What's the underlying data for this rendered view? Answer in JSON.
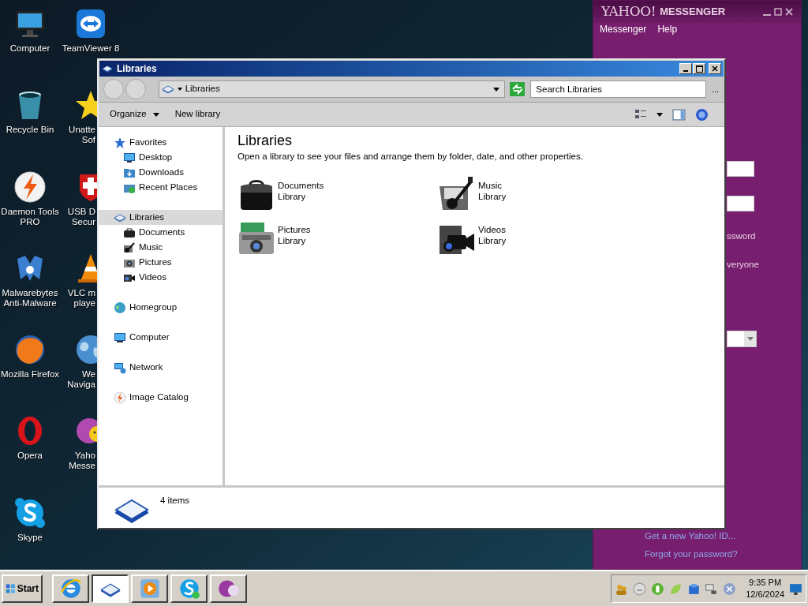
{
  "desktop": {
    "columns": [
      [
        {
          "lines": [
            "Computer"
          ]
        },
        {
          "lines": [
            "Recycle Bin"
          ]
        },
        {
          "lines": [
            "Daemon Tools",
            "PRO"
          ]
        },
        {
          "lines": [
            "Malwarebytes",
            "Anti-Malware"
          ]
        },
        {
          "lines": [
            "Mozilla Firefox"
          ]
        },
        {
          "lines": [
            "Opera"
          ]
        },
        {
          "lines": [
            "Skype"
          ]
        }
      ],
      [
        {
          "lines": [
            "TeamViewer 8"
          ]
        },
        {
          "lines": [
            "Unatte",
            "Sof"
          ]
        },
        {
          "lines": [
            "USB D",
            "Secur"
          ]
        },
        {
          "lines": [
            "VLC m",
            "playe"
          ]
        },
        {
          "lines": [
            "We",
            "Naviga"
          ]
        },
        {
          "lines": [
            "Yaho",
            "Messe"
          ]
        }
      ]
    ]
  },
  "messenger": {
    "logo": "YAHOO!",
    "title": "MESSENGER",
    "menu": [
      "Messenger",
      "Help"
    ],
    "form": [
      {
        "kind": "input"
      },
      {
        "kind": "input"
      },
      {
        "kind": "text",
        "text": "ssword"
      },
      {
        "kind": "text",
        "text": "veryone"
      },
      {
        "kind": "select"
      }
    ],
    "links": [
      "Get a new Yahoo! ID...",
      "Forgot your password?"
    ]
  },
  "explorer": {
    "title": "Libraries",
    "address": "Libraries",
    "search": {
      "placeholder": "Search Libraries"
    },
    "more": "...",
    "commands": [
      {
        "label": "Organize",
        "dropdown": true
      },
      {
        "label": "New library",
        "dropdown": false
      }
    ],
    "nav": [
      {
        "label": "Favorites",
        "selected": false,
        "children": [
          {
            "label": "Desktop",
            "selected": false
          },
          {
            "label": "Downloads",
            "selected": false
          },
          {
            "label": "Recent Places",
            "selected": false
          }
        ]
      },
      {
        "label": "Libraries",
        "selected": true,
        "children": [
          {
            "label": "Documents",
            "selected": false
          },
          {
            "label": "Music",
            "selected": false
          },
          {
            "label": "Pictures",
            "selected": false
          },
          {
            "label": "Videos",
            "selected": false
          }
        ]
      },
      {
        "label": "Homegroup",
        "selected": false
      },
      {
        "label": "Computer",
        "selected": false
      },
      {
        "label": "Network",
        "selected": false
      },
      {
        "label": "Image Catalog",
        "selected": false
      }
    ],
    "heading": "Libraries",
    "description": "Open a library to see your files and arrange them by folder, date, and other properties.",
    "items": [
      {
        "name": "Documents",
        "type": "Library"
      },
      {
        "name": "Music",
        "type": "Library"
      },
      {
        "name": "Pictures",
        "type": "Library"
      },
      {
        "name": "Videos",
        "type": "Library"
      }
    ],
    "status": "4 items"
  },
  "taskbar": {
    "start": "Start",
    "tasks": [
      {
        "selected": false
      },
      {
        "selected": true
      },
      {
        "selected": false
      },
      {
        "selected": false
      },
      {
        "selected": false
      }
    ],
    "clock": {
      "time": "9:35 PM",
      "date": "12/6/2024"
    }
  }
}
